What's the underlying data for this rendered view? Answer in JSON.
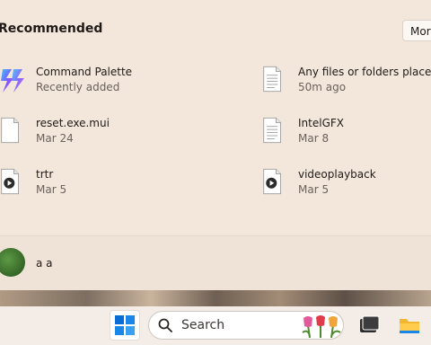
{
  "recommended": {
    "title": "Recommended",
    "more_label": "More",
    "items": [
      {
        "name": "Command Palette",
        "sub": "Recently added",
        "icon": "command-palette-icon"
      },
      {
        "name": "Any files or folders placed in",
        "sub": "50m ago",
        "icon": "document-icon"
      },
      {
        "name": "reset.exe.mui",
        "sub": "Mar 24",
        "icon": "file-icon"
      },
      {
        "name": "IntelGFX",
        "sub": "Mar 8",
        "icon": "document-icon"
      },
      {
        "name": "trtr",
        "sub": "Mar 5",
        "icon": "video-file-icon"
      },
      {
        "name": "videoplayback",
        "sub": "Mar 5",
        "icon": "video-file-icon"
      }
    ]
  },
  "user": {
    "name": "a a"
  },
  "taskbar": {
    "search_label": "Search",
    "apps": [
      "windows-start-icon",
      "search-icon",
      "tulips-icon",
      "terminal-icon",
      "file-explorer-icon"
    ]
  },
  "colors": {
    "panel_bg": "#f3e7dc",
    "taskbar_bg": "#f4ece6",
    "accent_blue": "#0a6cd6"
  }
}
